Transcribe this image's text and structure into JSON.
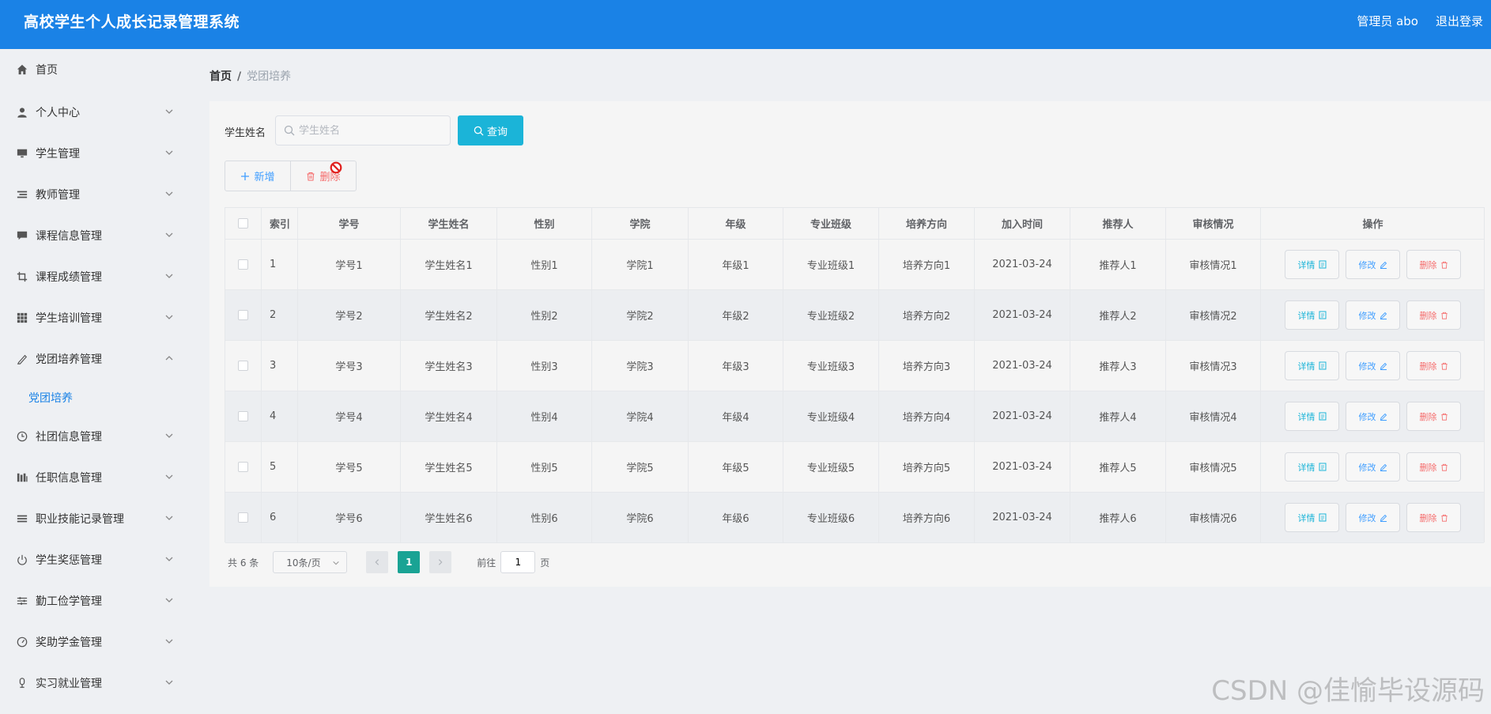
{
  "app": {
    "title": "高校学生个人成长记录管理系统",
    "admin_label": "管理员 abo",
    "logout_label": "退出登录"
  },
  "colors": {
    "header": "#1a82e6",
    "query_button": "#1bb4d8",
    "active_page": "#1aa394",
    "delete": "#f56c6c",
    "edit": "#409eff"
  },
  "sidebar": {
    "items": [
      {
        "label": "首页",
        "icon": "home-icon"
      },
      {
        "label": "个人中心",
        "icon": "user-icon"
      },
      {
        "label": "学生管理",
        "icon": "monitor-icon"
      },
      {
        "label": "教师管理",
        "icon": "list-icon"
      },
      {
        "label": "课程信息管理",
        "icon": "chat-icon"
      },
      {
        "label": "课程成绩管理",
        "icon": "crop-icon"
      },
      {
        "label": "学生培训管理",
        "icon": "grid-icon"
      },
      {
        "label": "党团培养管理",
        "icon": "pen-icon"
      },
      {
        "label": "社团信息管理",
        "icon": "clock-icon"
      },
      {
        "label": "任职信息管理",
        "icon": "columns-icon"
      },
      {
        "label": "职业技能记录管理",
        "icon": "menu-icon"
      },
      {
        "label": "学生奖惩管理",
        "icon": "power-icon"
      },
      {
        "label": "勤工俭学管理",
        "icon": "sliders-icon"
      },
      {
        "label": "奖助学金管理",
        "icon": "gauge-icon"
      },
      {
        "label": "实习就业管理",
        "icon": "mic-icon"
      }
    ],
    "active_sub": "党团培养"
  },
  "breadcrumb": {
    "home": "首页",
    "sep": "/",
    "current": "党团培养"
  },
  "search": {
    "label": "学生姓名",
    "placeholder": "学生姓名",
    "value": "",
    "button": "查询"
  },
  "actions": {
    "add": "新增",
    "delete": "删除"
  },
  "table": {
    "columns": [
      "索引",
      "学号",
      "学生姓名",
      "性别",
      "学院",
      "年级",
      "专业班级",
      "培养方向",
      "加入时间",
      "推荐人",
      "审核情况",
      "操作"
    ],
    "rows": [
      [
        "1",
        "学号1",
        "学生姓名1",
        "性别1",
        "学院1",
        "年级1",
        "专业班级1",
        "培养方向1",
        "2021-03-24",
        "推荐人1",
        "审核情况1"
      ],
      [
        "2",
        "学号2",
        "学生姓名2",
        "性别2",
        "学院2",
        "年级2",
        "专业班级2",
        "培养方向2",
        "2021-03-24",
        "推荐人2",
        "审核情况2"
      ],
      [
        "3",
        "学号3",
        "学生姓名3",
        "性别3",
        "学院3",
        "年级3",
        "专业班级3",
        "培养方向3",
        "2021-03-24",
        "推荐人3",
        "审核情况3"
      ],
      [
        "4",
        "学号4",
        "学生姓名4",
        "性别4",
        "学院4",
        "年级4",
        "专业班级4",
        "培养方向4",
        "2021-03-24",
        "推荐人4",
        "审核情况4"
      ],
      [
        "5",
        "学号5",
        "学生姓名5",
        "性别5",
        "学院5",
        "年级5",
        "专业班级5",
        "培养方向5",
        "2021-03-24",
        "推荐人5",
        "审核情况5"
      ],
      [
        "6",
        "学号6",
        "学生姓名6",
        "性别6",
        "学院6",
        "年级6",
        "专业班级6",
        "培养方向6",
        "2021-03-24",
        "推荐人6",
        "审核情况6"
      ]
    ],
    "row_actions": {
      "detail": "详情",
      "edit": "修改",
      "delete": "删除"
    }
  },
  "pagination": {
    "total": "共 6 条",
    "page_size": "10条/页",
    "current_page": "1",
    "goto_prefix": "前往",
    "goto_value": "1",
    "goto_suffix": "页"
  },
  "watermark": "CSDN @佳愉毕设源码"
}
